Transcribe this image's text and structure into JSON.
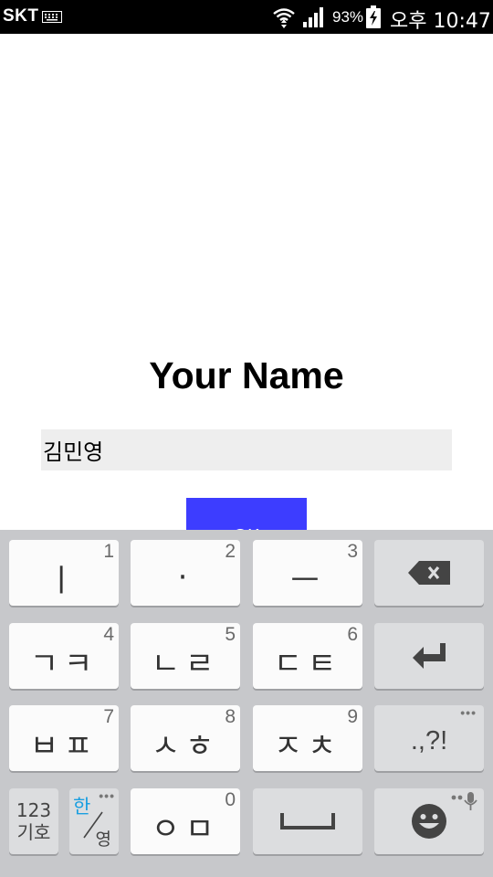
{
  "status_bar": {
    "carrier": "SKT",
    "battery_percent": "93%",
    "time": "오후 10:47"
  },
  "app": {
    "title": "Your Name",
    "name_input_value": "김민영",
    "ok_label": "OK"
  },
  "keyboard": {
    "rows": [
      [
        {
          "name": "key-i",
          "main": "ㅣ",
          "num": "1"
        },
        {
          "name": "key-dot",
          "main": "·",
          "num": "2"
        },
        {
          "name": "key-eu",
          "main": "ㅡ",
          "num": "3"
        },
        {
          "name": "backspace-key",
          "icon": "backspace-icon"
        }
      ],
      [
        {
          "name": "key-giyeok-kieuk",
          "main": "ㄱㅋ",
          "num": "4"
        },
        {
          "name": "key-nieun-rieul",
          "main": "ㄴㄹ",
          "num": "5"
        },
        {
          "name": "key-digeut-tieut",
          "main": "ㄷㅌ",
          "num": "6"
        },
        {
          "name": "enter-key",
          "icon": "enter-icon"
        }
      ],
      [
        {
          "name": "key-bieup-pieup",
          "main": "ㅂㅍ",
          "num": "7"
        },
        {
          "name": "key-siot-hieut",
          "main": "ㅅㅎ",
          "num": "8"
        },
        {
          "name": "key-jieut-chieut",
          "main": "ㅈㅊ",
          "num": "9"
        },
        {
          "name": "punctuation-key",
          "main": ".,?!"
        }
      ]
    ],
    "symbols_key": {
      "line1": "123",
      "line2": "기호"
    },
    "lang_key": {
      "active": "한",
      "other": "영"
    },
    "ieung_key": {
      "main": "ㅇㅁ",
      "num": "0"
    },
    "colors": {
      "background": "#c7c8cb",
      "white_key": "#fbfbfb",
      "grey_key": "#dcdddf",
      "accent": "#1a9fe0",
      "button": "#3d3dff"
    }
  }
}
